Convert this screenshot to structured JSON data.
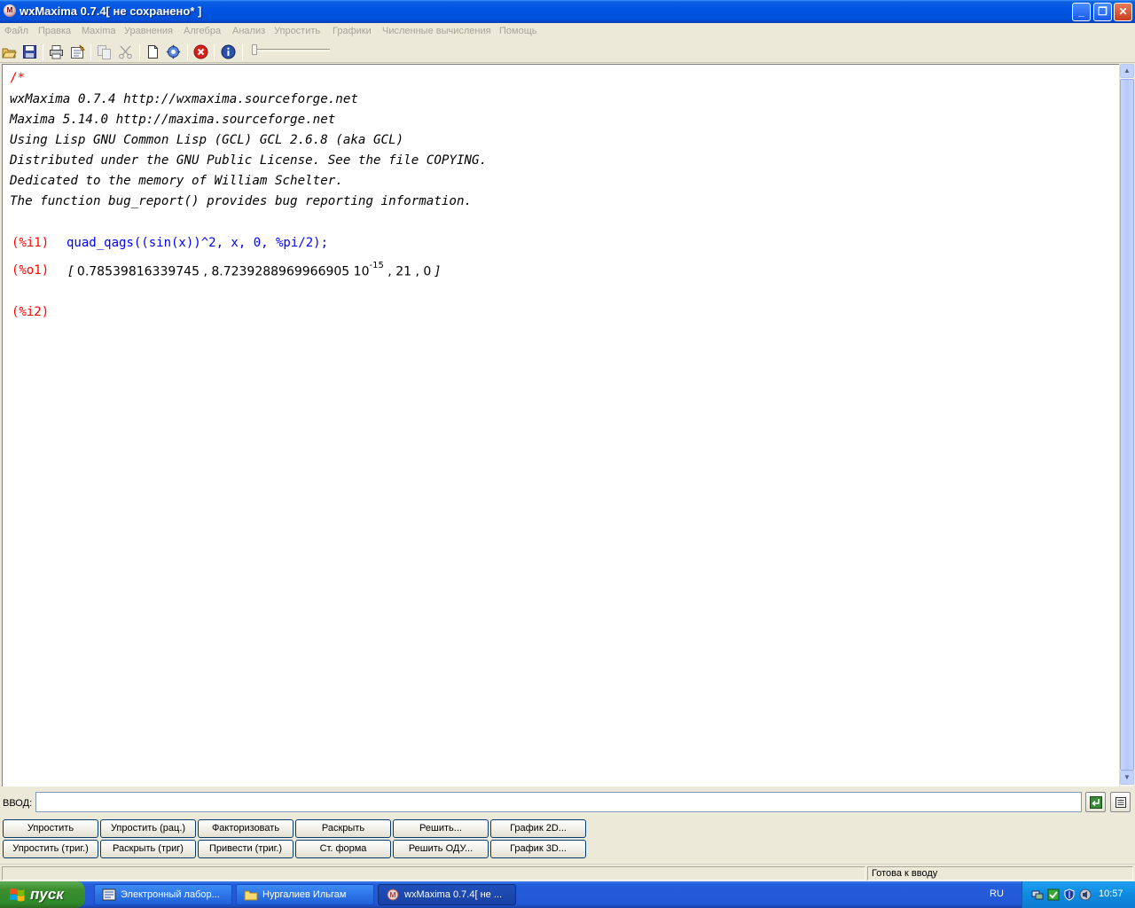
{
  "window": {
    "title": "wxMaxima 0.7.4[ не сохранено* ]",
    "icon": "maxima-app-icon",
    "controls": {
      "minimize": "_",
      "maximize": "❐",
      "close": "✕"
    }
  },
  "menu": [
    "Файл",
    "Правка",
    "Maxima",
    "Уравнения",
    "Алгебра",
    "Анализ",
    "Упростить",
    "Графики",
    "Численные вычисления",
    "Помощь"
  ],
  "toolbar": {
    "icons": [
      "open-icon",
      "save-icon",
      "print-icon",
      "configure-icon",
      "copy-icon",
      "cut-icon",
      "new-icon",
      "settings-icon",
      "interrupt-icon",
      "info-icon"
    ]
  },
  "worksheet": {
    "header_lines": [
      "/*",
      "wxMaxima 0.7.4 http://wxmaxima.sourceforge.net",
      "Maxima 5.14.0 http://maxima.sourceforge.net",
      "Using Lisp GNU Common Lisp (GCL) GCL 2.6.8 (aka GCL)",
      "Distributed under the GNU Public License. See the file COPYING.",
      "Dedicated to the memory of William Schelter.",
      "The function bug_report() provides bug reporting information."
    ],
    "cells": {
      "i1_label": "(%i1)",
      "i1_input": "quad_qags((sin(x))^2, x, 0, %pi/2);",
      "o1_label": "(%o1)",
      "o1_open": "[",
      "o1_v1": "0.78539816339745",
      "o1_sep1": ",",
      "o1_mantissa": "8.7239288969966905",
      "o1_base": "10",
      "o1_exp": "-15",
      "o1_sep2": ",",
      "o1_v3": "21",
      "o1_sep3": ",",
      "o1_v4": "0",
      "o1_close": "]",
      "i2_label": "(%i2)"
    }
  },
  "input_bar": {
    "label": "ВВОД:",
    "value": "",
    "enter_icon": "enter-icon",
    "history_icon": "history-icon"
  },
  "buttons": {
    "row1": [
      "Упростить",
      "Упростить (рац.)",
      "Факторизовать",
      "Раскрыть",
      "Решить...",
      "График 2D..."
    ],
    "row2": [
      "Упростить (триг.)",
      "Раскрыть (триг)",
      "Привести (триг.)",
      "Ст. форма",
      "Решить ОДУ...",
      "График 3D..."
    ]
  },
  "status": {
    "text": "Готова к вводу"
  },
  "taskbar": {
    "start_label": "пуск",
    "tasks": [
      {
        "label": "Электронный лабор...",
        "icon": "document-icon"
      },
      {
        "label": "Нургалиев Ильгам",
        "icon": "folder-icon"
      },
      {
        "label": "wxMaxima 0.7.4[ не ...",
        "icon": "maxima-app-icon"
      }
    ],
    "language": "RU",
    "clock": "10:57"
  }
}
